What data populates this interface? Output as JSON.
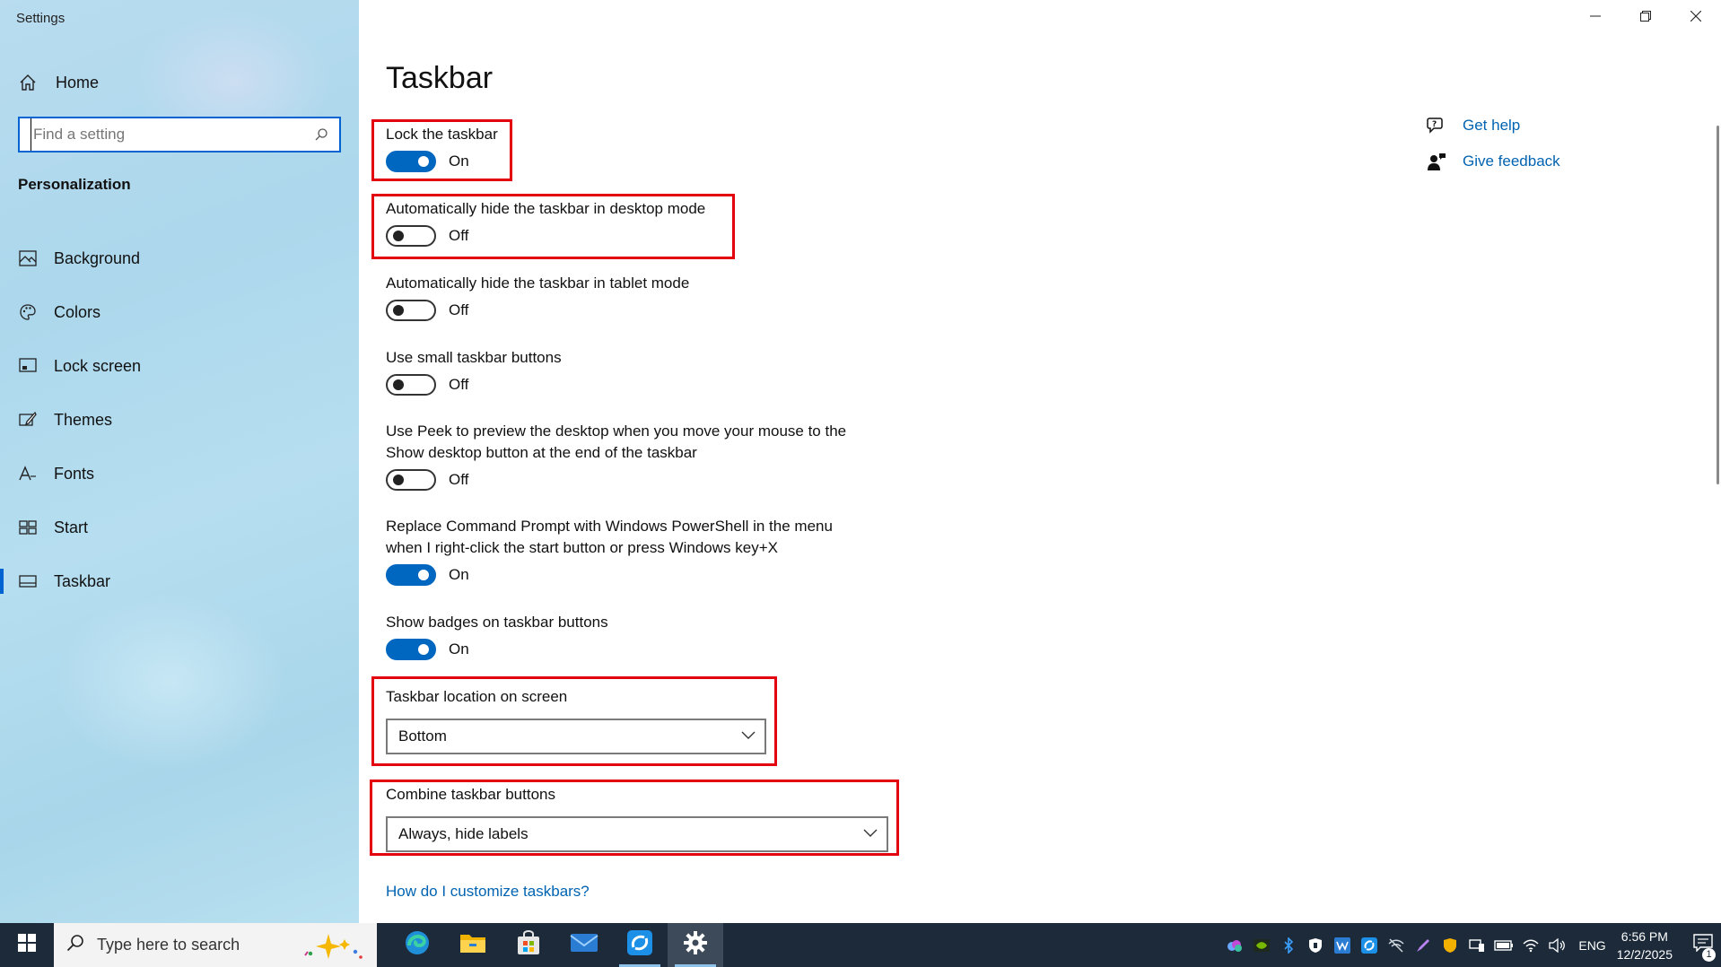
{
  "window": {
    "title": "Settings"
  },
  "sidebar": {
    "home_label": "Home",
    "search_placeholder": "Find a setting",
    "section_title": "Personalization",
    "items": [
      {
        "label": "Background",
        "icon": "picture-icon",
        "selected": false
      },
      {
        "label": "Colors",
        "icon": "palette-icon",
        "selected": false
      },
      {
        "label": "Lock screen",
        "icon": "lock-screen-icon",
        "selected": false
      },
      {
        "label": "Themes",
        "icon": "brush-icon",
        "selected": false
      },
      {
        "label": "Fonts",
        "icon": "font-icon",
        "selected": false
      },
      {
        "label": "Start",
        "icon": "start-tiles-icon",
        "selected": false
      },
      {
        "label": "Taskbar",
        "icon": "taskbar-icon",
        "selected": true
      }
    ]
  },
  "main": {
    "title": "Taskbar",
    "settings": [
      {
        "label": "Lock the taskbar",
        "state": "On"
      },
      {
        "label": "Automatically hide the taskbar in desktop mode",
        "state": "Off"
      },
      {
        "label": "Automatically hide the taskbar in tablet mode",
        "state": "Off"
      },
      {
        "label": "Use small taskbar buttons",
        "state": "Off"
      },
      {
        "label_line1": "Use Peek to preview the desktop when you move your mouse to the",
        "label_line2": "Show desktop button at the end of the taskbar",
        "state": "Off"
      },
      {
        "label_line1": "Replace Command Prompt with Windows PowerShell in the menu",
        "label_line2": "when I right-click the start button or press Windows key+X",
        "state": "On"
      },
      {
        "label": "Show badges on taskbar buttons",
        "state": "On"
      }
    ],
    "location": {
      "label": "Taskbar location on screen",
      "value": "Bottom"
    },
    "combine": {
      "label": "Combine taskbar buttons",
      "value": "Always, hide labels"
    },
    "help_link": "How do I customize taskbars?",
    "side_links": {
      "get_help": "Get help",
      "give_feedback": "Give feedback"
    }
  },
  "taskbar": {
    "search_placeholder": "Type here to search",
    "apps": [
      "edge-icon",
      "file-explorer-icon",
      "store-icon",
      "mail-icon",
      "quick-assist-icon",
      "settings-gear-icon"
    ],
    "language": "ENG",
    "time": "6:56 PM",
    "date": "12/2/2025",
    "notification_count": "1"
  },
  "colors": {
    "accent": "#0067c0",
    "highlight_box": "#e3000f",
    "link": "#0063b1",
    "taskbar_bg": "#1c2a3a"
  }
}
